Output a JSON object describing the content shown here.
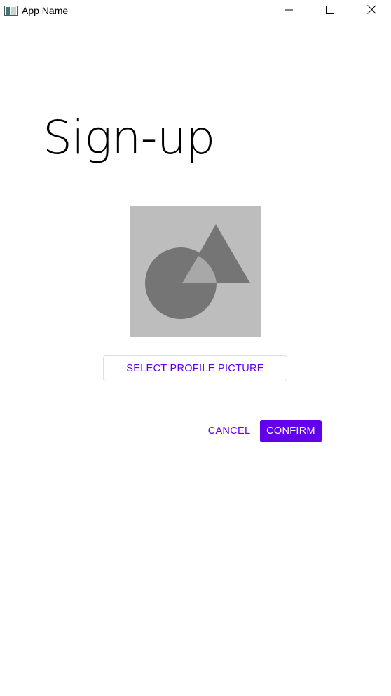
{
  "window": {
    "title": "App Name",
    "icon": "app-window-icon",
    "controls": {
      "minimize": "minimize-icon",
      "maximize": "maximize-icon",
      "close": "close-icon"
    }
  },
  "signup": {
    "title": "Sign-up",
    "profile_picture": {
      "icon": "image-placeholder-icon"
    },
    "select_picture_label": "SELECT PROFILE PICTURE",
    "cancel_label": "CANCEL",
    "confirm_label": "CONFIRM"
  },
  "colors": {
    "accent": "#6200ee",
    "placeholder_bg": "#bdbdbd",
    "placeholder_shape": "#757575"
  }
}
